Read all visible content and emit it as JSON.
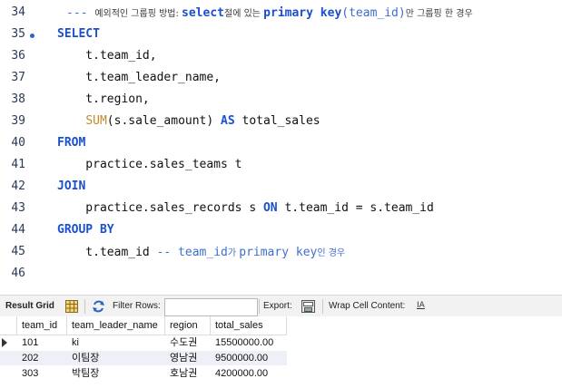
{
  "editor": {
    "lines": [
      {
        "num": "34",
        "segments": [
          {
            "t": "--- ",
            "c": "cm"
          },
          {
            "t": "예외적인 그룹핑 방법: ",
            "c": "ko"
          },
          {
            "t": "select",
            "c": "cm-b"
          },
          {
            "t": "절에 있는 ",
            "c": "ko"
          },
          {
            "t": "primary key",
            "c": "cm-b"
          },
          {
            "t": "(team_id)",
            "c": "cm"
          },
          {
            "t": "만 그룹핑 한 경우",
            "c": "ko"
          }
        ]
      },
      {
        "num": "35",
        "dot": true,
        "segments": [
          {
            "t": "SELECT",
            "c": "kw"
          }
        ]
      },
      {
        "num": "36",
        "segments": [
          {
            "t": "    t.team_id,",
            "c": ""
          }
        ]
      },
      {
        "num": "37",
        "segments": [
          {
            "t": "    t.team_leader_name,",
            "c": ""
          }
        ]
      },
      {
        "num": "38",
        "segments": [
          {
            "t": "    t.region,",
            "c": ""
          }
        ]
      },
      {
        "num": "39",
        "segments": [
          {
            "t": "    ",
            "c": ""
          },
          {
            "t": "SUM",
            "c": "fn"
          },
          {
            "t": "(s.sale_amount) ",
            "c": ""
          },
          {
            "t": "AS",
            "c": "kw"
          },
          {
            "t": " total_sales",
            "c": ""
          }
        ]
      },
      {
        "num": "40",
        "segments": [
          {
            "t": "FROM",
            "c": "kw"
          }
        ]
      },
      {
        "num": "41",
        "segments": [
          {
            "t": "    practice.sales_teams t",
            "c": ""
          }
        ]
      },
      {
        "num": "42",
        "segments": [
          {
            "t": "JOIN",
            "c": "kw"
          }
        ]
      },
      {
        "num": "43",
        "segments": [
          {
            "t": "    practice.sales_records s ",
            "c": ""
          },
          {
            "t": "ON",
            "c": "kw"
          },
          {
            "t": " t.team_id = s.team_id",
            "c": ""
          }
        ]
      },
      {
        "num": "44",
        "segments": [
          {
            "t": "GROUP BY",
            "c": "kw"
          }
        ]
      },
      {
        "num": "45",
        "segments": [
          {
            "t": "    t.team_id ",
            "c": ""
          },
          {
            "t": "-- team_id",
            "c": "cm"
          },
          {
            "t": "가 ",
            "c": "ko-c"
          },
          {
            "t": "primary key",
            "c": "cm"
          },
          {
            "t": "인 경우",
            "c": "ko-c"
          }
        ]
      },
      {
        "num": "46",
        "segments": []
      }
    ]
  },
  "toolbar": {
    "result_grid_label": "Result Grid",
    "filter_rows_label": "Filter Rows:",
    "filter_value": "",
    "export_label": "Export:",
    "wrap_label": "Wrap Cell Content:",
    "wrap_icon_glyph": "IA"
  },
  "grid": {
    "columns": [
      "team_id",
      "team_leader_name",
      "region",
      "total_sales"
    ],
    "rows": [
      [
        "101",
        "ki",
        "수도권",
        "15500000.00"
      ],
      [
        "202",
        "이팀장",
        "영남권",
        "9500000.00"
      ],
      [
        "303",
        "박팀장",
        "호남권",
        "4200000.00"
      ]
    ]
  },
  "colors": {
    "keyword": "#1a4fd0",
    "function": "#c08a2a",
    "comment": "#3f6ecf",
    "alt_row": "#eef0f8"
  }
}
